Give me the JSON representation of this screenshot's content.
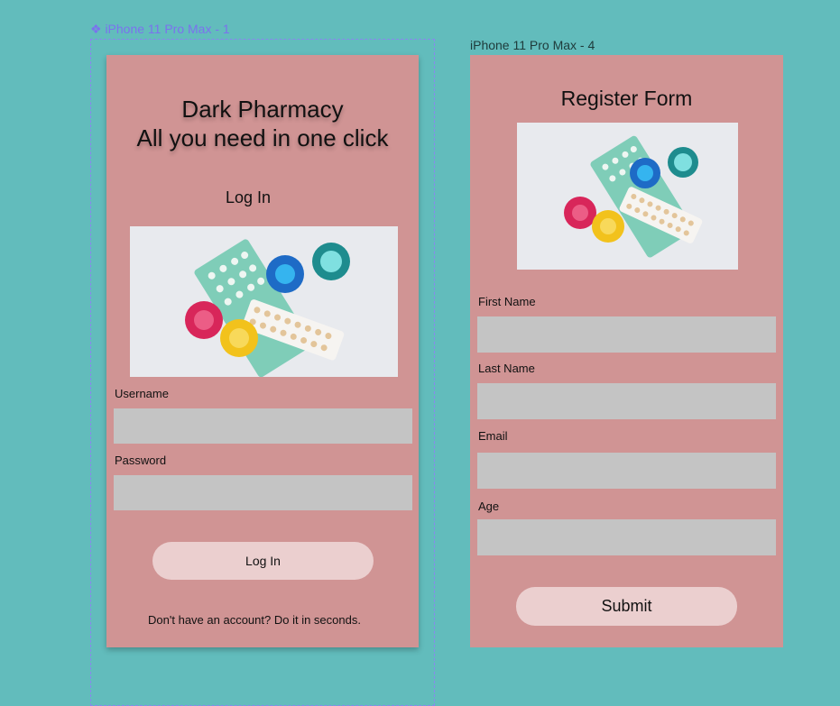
{
  "canvas": {
    "background": "#62bcbc",
    "phone_color": "#d09494",
    "input_color": "#c4c4c4",
    "button_color": "#ebcfcf",
    "selection_color": "#7b72ee"
  },
  "login_frame": {
    "frame_label": "❖ iPhone 11 Pro Max - 1",
    "title_line1": "Dark Pharmacy",
    "title_line2": "All you need in one click",
    "subtitle": "Log In",
    "image_icon": "contraceptives-photo",
    "username_label": "Username",
    "username_value": "",
    "password_label": "Password",
    "password_value": "",
    "login_button": "Log In",
    "signup_prompt": "Don't have an account? Do it in seconds."
  },
  "register_frame": {
    "frame_label": "iPhone 11 Pro Max - 4",
    "title": "Register Form",
    "image_icon": "contraceptives-photo",
    "fields": [
      {
        "label": "First Name",
        "value": ""
      },
      {
        "label": "Last Name",
        "value": ""
      },
      {
        "label": "Email",
        "value": ""
      },
      {
        "label": "Age",
        "value": ""
      }
    ],
    "submit_button": "Submit"
  }
}
